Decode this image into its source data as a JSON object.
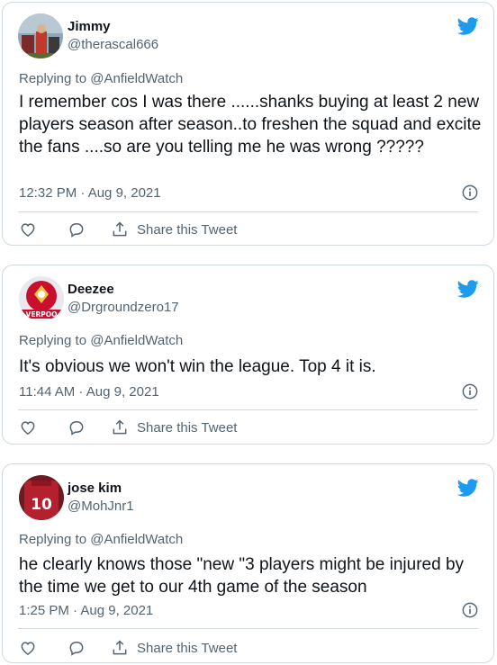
{
  "colors": {
    "brand": "#1d9bf0",
    "text": "#0f1419",
    "secondary": "#536471",
    "border": "#cfd9de"
  },
  "icons": [
    "twitter-bird-icon",
    "info-icon",
    "heart-icon",
    "reply-icon",
    "share-icon"
  ],
  "tweets": [
    {
      "name": "Jimmy",
      "handle": "@therascal666",
      "replying_prefix": "Replying to ",
      "replying_to": "@AnfieldWatch",
      "text": "I remember cos I was there ......shanks buying at least 2 new players season  after season..to freshen the squad and excite the fans ....so are you telling me he was wrong ?????",
      "timestamp": "12:32 PM · Aug 9, 2021",
      "share_label": "Share this Tweet"
    },
    {
      "name": "Deezee",
      "handle": "@Drgroundzero17",
      "replying_prefix": "Replying to ",
      "replying_to": "@AnfieldWatch",
      "avatar_text": "VERPOO",
      "text": "It's obvious we won't win the league. Top 4 it is.",
      "timestamp": "11:44 AM · Aug 9, 2021",
      "share_label": "Share this Tweet"
    },
    {
      "name": "jose kim",
      "handle": "@MohJnr1",
      "replying_prefix": "Replying to ",
      "replying_to": "@AnfieldWatch",
      "avatar_text": "10",
      "text": "he clearly knows those \"new \"3 players might be injured by the time we get to our 4th game of the season",
      "timestamp": "1:25 PM · Aug 9, 2021",
      "share_label": "Share this Tweet"
    }
  ]
}
